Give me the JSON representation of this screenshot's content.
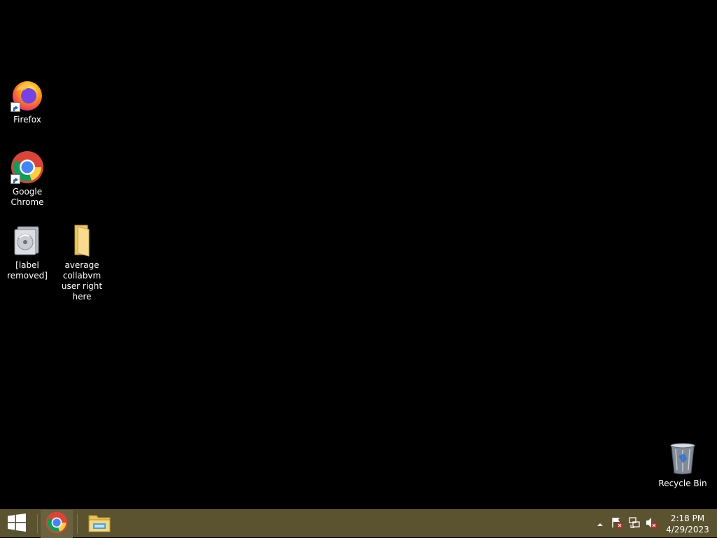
{
  "desktop": {
    "icons": [
      {
        "label": "Firefox",
        "icon": "firefox-icon"
      },
      {
        "label": "Google Chrome",
        "icon": "chrome-icon"
      },
      {
        "label": "[label removed]",
        "icon": "installer-disc-icon"
      },
      {
        "label": "average collabvm user right here",
        "icon": "folder-icon"
      },
      {
        "label": "Recycle Bin",
        "icon": "recycle-bin-icon"
      }
    ]
  },
  "taskbar": {
    "start_icon": "windows-logo-icon",
    "pinned": [
      {
        "icon": "chrome-icon",
        "active": true
      },
      {
        "icon": "file-explorer-icon",
        "active": false
      }
    ],
    "tray": {
      "icons": [
        "show-hidden-icons-chevron",
        "action-center-flag-icon",
        "network-icon",
        "volume-muted-icon"
      ]
    },
    "clock": {
      "time": "2:18 PM",
      "date": "4/29/2023"
    }
  },
  "colors": {
    "desktop_background": "#000000",
    "taskbar": "#5b5230"
  }
}
